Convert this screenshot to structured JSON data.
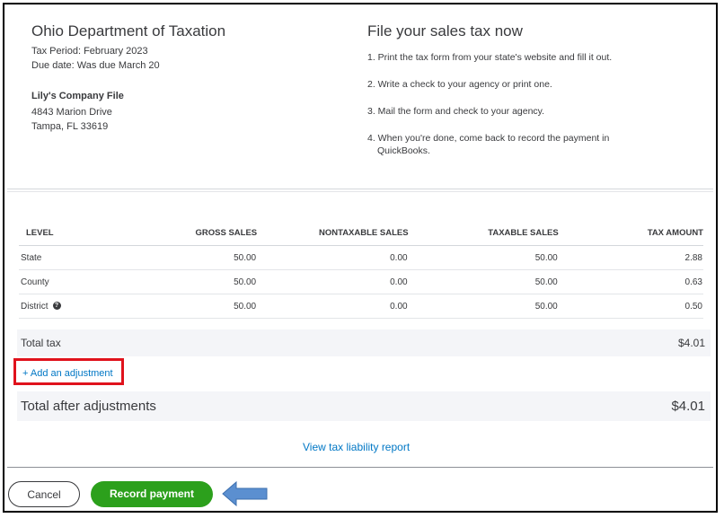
{
  "agency": {
    "name": "Ohio Department of Taxation",
    "tax_period": "Tax Period: February 2023",
    "due_date": "Due date:  Was due March 20",
    "company": "Lily's Company File",
    "address_line1": "4843 Marion Drive",
    "address_line2": "Tampa, FL 33619"
  },
  "instructions": {
    "title": "File your sales tax now",
    "step1": "1. Print the tax form from your state's website and fill it out.",
    "step2": "2. Write a check to your agency or print one.",
    "step3": "3. Mail the form and check to your agency.",
    "step4_line1": "4. When you're done, come back to record the payment in",
    "step4_line2": "QuickBooks."
  },
  "table": {
    "headers": [
      "LEVEL",
      "GROSS SALES",
      "NONTAXABLE SALES",
      "TAXABLE SALES",
      "TAX AMOUNT"
    ],
    "rows": [
      [
        "State",
        "50.00",
        "0.00",
        "50.00",
        "2.88"
      ],
      [
        "County",
        "50.00",
        "0.00",
        "50.00",
        "0.63"
      ],
      [
        "District",
        "50.00",
        "0.00",
        "50.00",
        "0.50"
      ]
    ]
  },
  "totals": {
    "total_tax_label": "Total tax",
    "total_tax_value": "$4.01",
    "add_adjustment": "+ Add an adjustment",
    "after_label": "Total after adjustments",
    "after_value": "$4.01"
  },
  "links": {
    "report": "View tax liability report"
  },
  "footer": {
    "cancel": "Cancel",
    "record": "Record payment"
  },
  "colors": {
    "brand_green": "#2ca01c",
    "link_blue": "#0077c5",
    "highlight_red": "#e0121c",
    "arrow_blue": "#5b8fd0"
  },
  "icons": {
    "district_help": "help-icon",
    "annotation_arrow": "left-arrow-icon"
  }
}
